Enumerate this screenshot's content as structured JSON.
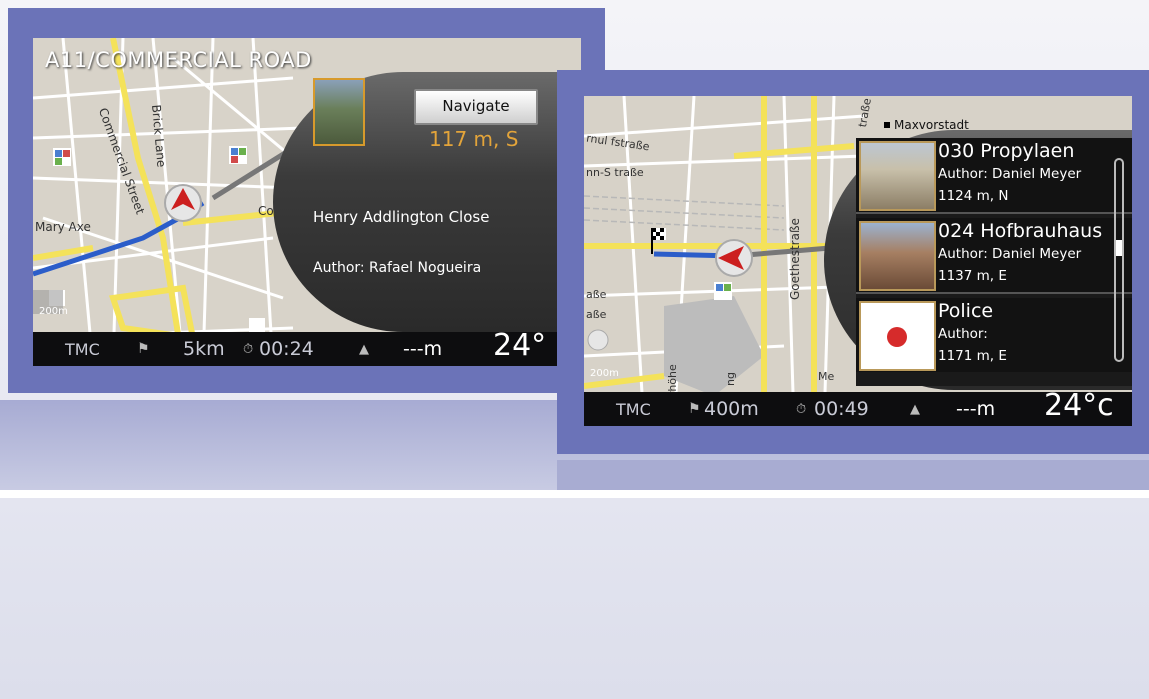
{
  "left_screen": {
    "street_title": "A11/COMMERCIAL ROAD",
    "navigate_label": "Navigate",
    "distance": "117 m, S",
    "poi_name": "Henry Addlington Close",
    "poi_author": "Author: Rafael Nogueira",
    "map_labels": {
      "commercial_street": "Commercial Street",
      "brick_lane": "Brick Lane",
      "mary_axe": "Mary Axe",
      "co": "Co"
    },
    "scale": "200m",
    "status": {
      "tmc": "TMC",
      "distance": "5km",
      "time": "00:24",
      "altitude": "---m",
      "temperature": "24°"
    }
  },
  "right_screen": {
    "location_label": "Maxvorstadt",
    "map_labels": {
      "strasse1": "rnul fstraße",
      "strasse2": "nn-S traße",
      "strasse3": "aße",
      "strasse4": "aße",
      "goethe": "Goethestraße",
      "hohe": "rhöhe",
      "ng": "ng",
      "me": "Me",
      "strasse_top": "traße"
    },
    "scale": "200m",
    "poi_list": [
      {
        "title": "030 Propylaen",
        "author": "Author: Daniel Meyer",
        "distance": "1124 m, N"
      },
      {
        "title": "024 Hofbrauhaus",
        "author": "Author: Daniel Meyer",
        "distance": "1137 m, E"
      },
      {
        "title": "Police",
        "author": "Author:",
        "distance": "1171 m, E"
      }
    ],
    "status": {
      "tmc": "TMC",
      "distance": "400m",
      "time": "00:49",
      "altitude": "---m",
      "temperature": "24°c"
    }
  }
}
